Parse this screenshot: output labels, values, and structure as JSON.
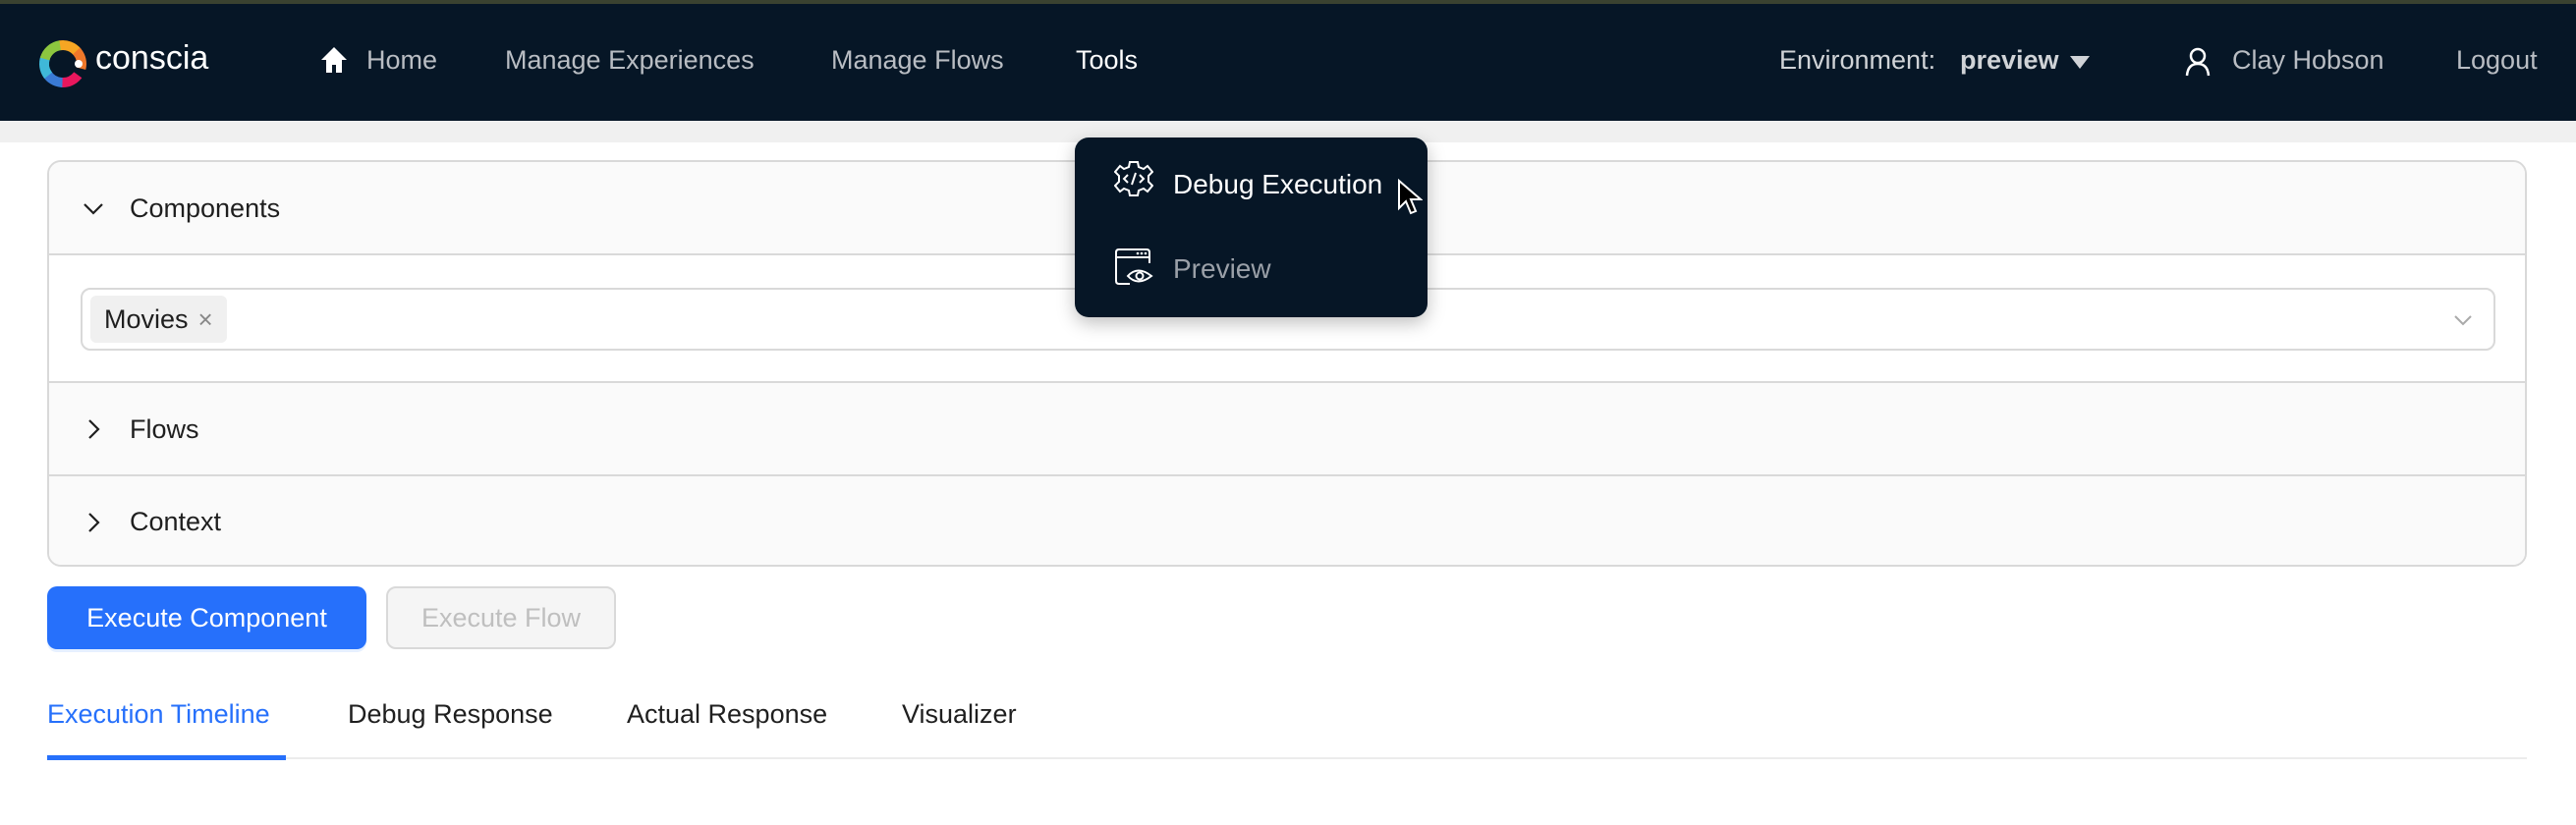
{
  "nav": {
    "logo_text": "conscia",
    "items": [
      {
        "label": "Home",
        "icon": "home-icon"
      },
      {
        "label": "Manage Experiences"
      },
      {
        "label": "Manage Flows"
      },
      {
        "label": "Tools"
      }
    ],
    "environment_label": "Environment:",
    "environment_value": "preview",
    "user_name": "Clay Hobson",
    "logout": "Logout"
  },
  "tools_menu": {
    "items": [
      {
        "label": "Debug Execution",
        "icon": "gear-code-icon"
      },
      {
        "label": "Preview",
        "icon": "window-eye-icon"
      }
    ]
  },
  "panels": {
    "components": {
      "label": "Components",
      "expanded": true,
      "selected_tags": [
        "Movies"
      ]
    },
    "flows": {
      "label": "Flows",
      "expanded": false
    },
    "context": {
      "label": "Context",
      "expanded": false
    }
  },
  "actions": {
    "execute_component": "Execute Component",
    "execute_flow": "Execute Flow"
  },
  "tabs": [
    {
      "label": "Execution Timeline",
      "active": true
    },
    {
      "label": "Debug Response"
    },
    {
      "label": "Actual Response"
    },
    {
      "label": "Visualizer"
    }
  ],
  "colors": {
    "nav_bg": "#061626",
    "primary": "#2670fb"
  }
}
